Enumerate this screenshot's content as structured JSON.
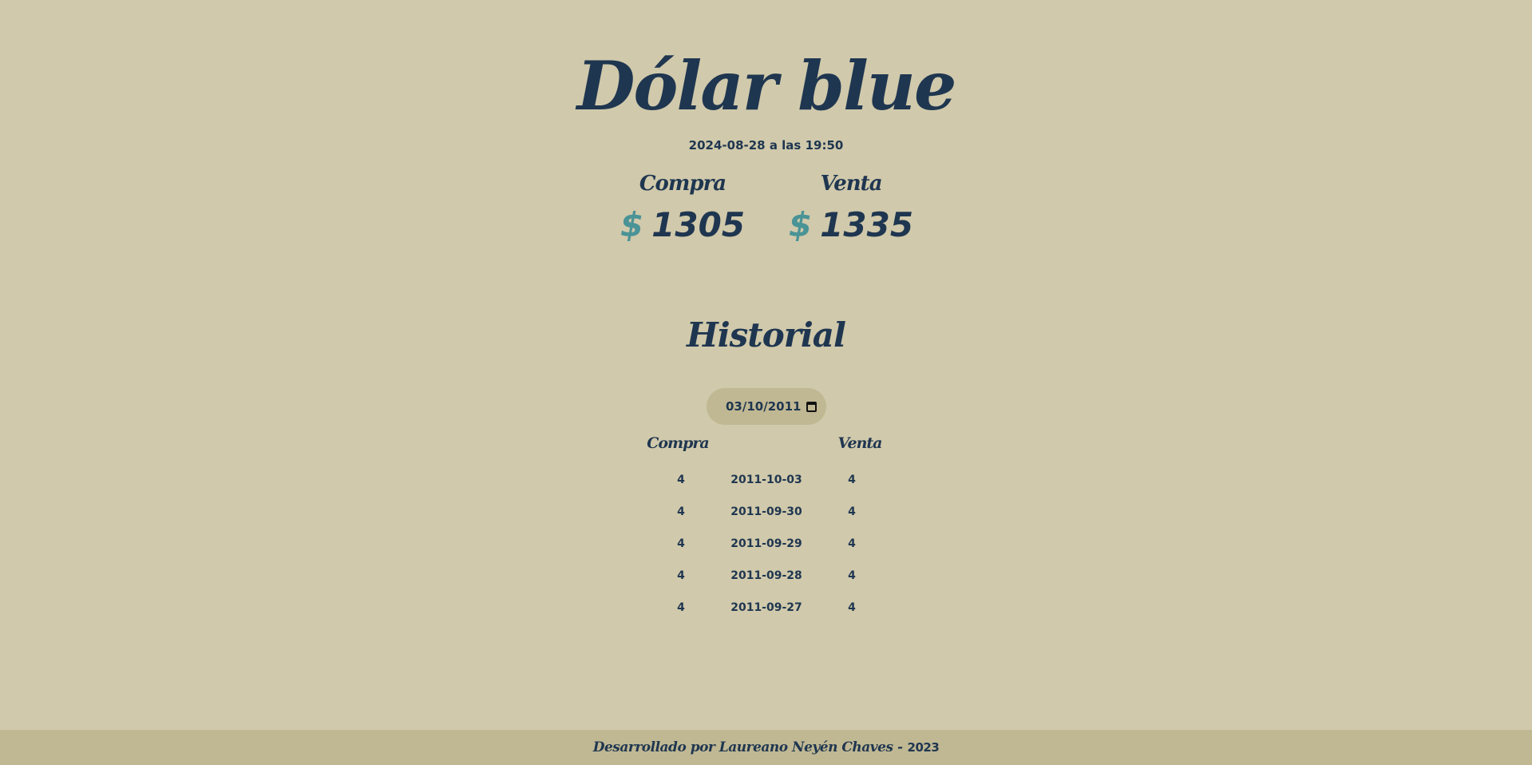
{
  "header": {
    "title": "Dólar blue",
    "timestamp": "2024-08-28 a las 19:50"
  },
  "quotes": {
    "compra": {
      "label": "Compra",
      "currency": "$",
      "value": "1305"
    },
    "venta": {
      "label": "Venta",
      "currency": "$",
      "value": "1335"
    }
  },
  "history": {
    "title": "Historial",
    "date_input_value": "03/10/2011",
    "columns": {
      "compra": "Compra",
      "venta": "Venta"
    },
    "rows": [
      {
        "compra": "4",
        "fecha": "2011-10-03",
        "venta": "4"
      },
      {
        "compra": "4",
        "fecha": "2011-09-30",
        "venta": "4"
      },
      {
        "compra": "4",
        "fecha": "2011-09-29",
        "venta": "4"
      },
      {
        "compra": "4",
        "fecha": "2011-09-28",
        "venta": "4"
      },
      {
        "compra": "4",
        "fecha": "2011-09-27",
        "venta": "4"
      }
    ]
  },
  "footer": {
    "credit": "Desarrollado por Laureano Neyén Chaves -",
    "year": "2023"
  },
  "colors": {
    "background": "#d0c9ab",
    "panel": "#c0b893",
    "text": "#1f3650",
    "accent": "#4a9396"
  }
}
